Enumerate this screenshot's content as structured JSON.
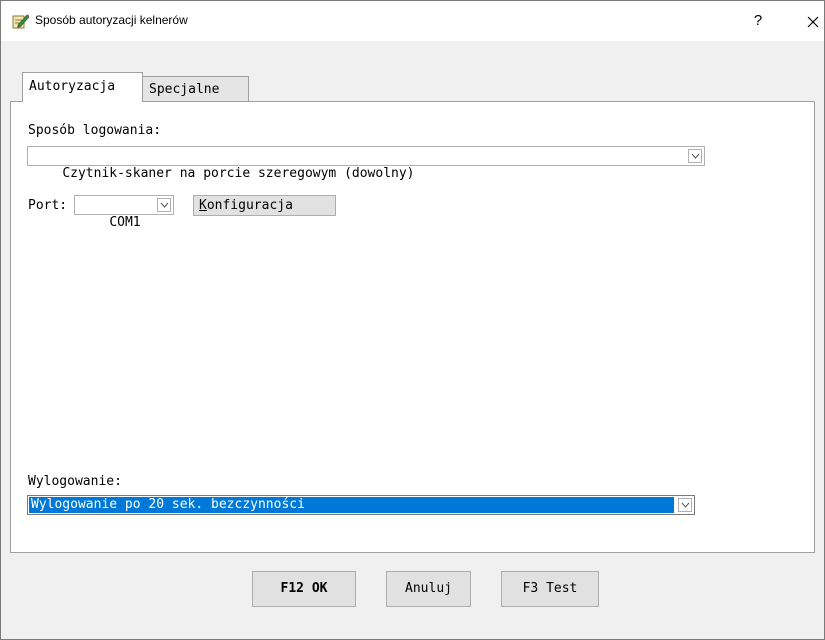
{
  "window": {
    "title": "Sposób autoryzacji kelnerów",
    "help_label": "?",
    "close_label": "✕",
    "app_icon": "pencil-notepad-icon"
  },
  "tabs": [
    {
      "label": "Autoryzacja",
      "active": true
    },
    {
      "label": "Specjalne",
      "active": false
    }
  ],
  "login": {
    "label": "Sposób logowania:",
    "value": "Czytnik-skaner na porcie szeregowym (dowolny)"
  },
  "port": {
    "label": "Port:",
    "value": "COM1",
    "config_button_first": "K",
    "config_button_rest": "onfiguracja"
  },
  "logout": {
    "label": "Wylogowanie:",
    "value": "Wylogowanie po 20 sek. bezczynności"
  },
  "buttons": {
    "ok": "F12 OK",
    "cancel": "Anuluj",
    "test": "F3 Test"
  },
  "colors": {
    "selection": "#0078d7",
    "background": "#f0f0f0"
  }
}
